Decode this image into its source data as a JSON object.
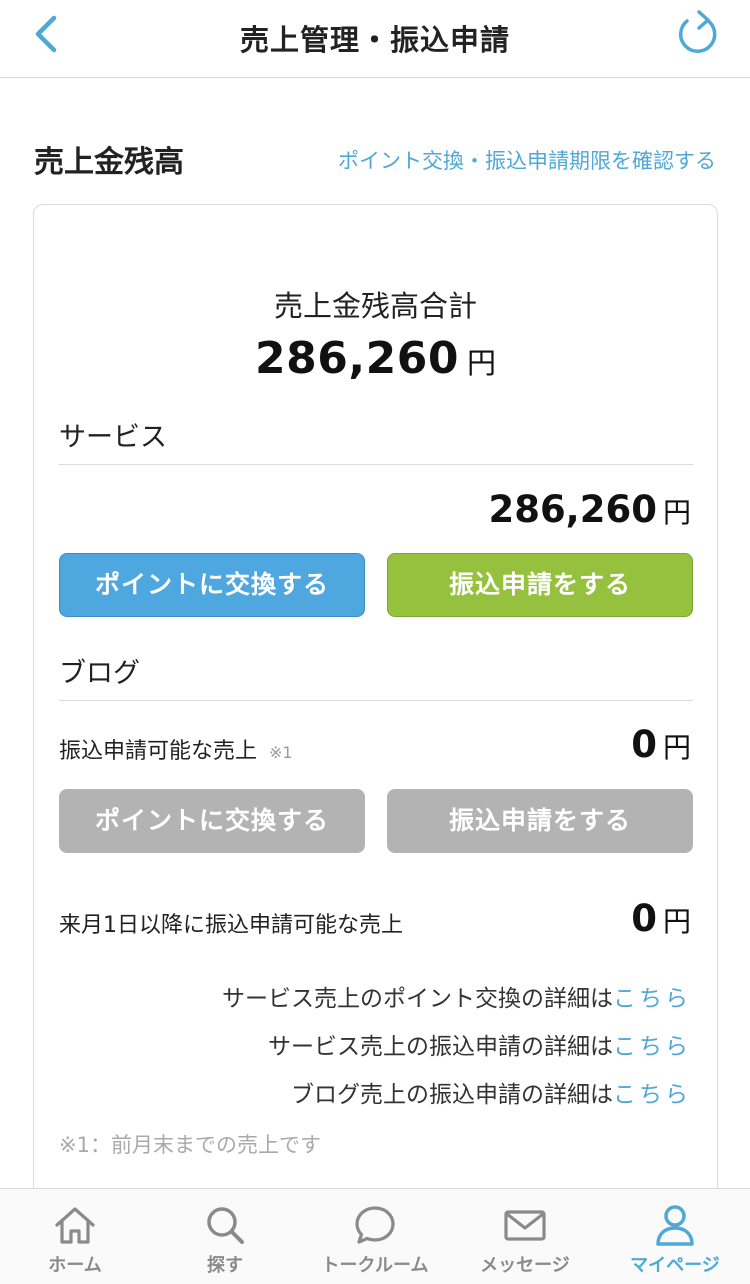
{
  "header": {
    "title": "売上管理・振込申請"
  },
  "section": {
    "title": "売上金残高",
    "period_link": "ポイント交換・振込申請期限を確認する"
  },
  "total": {
    "label": "売上金残高合計",
    "amount": "286,260",
    "unit": "円"
  },
  "service": {
    "heading": "サービス",
    "amount": "286,260",
    "unit": "円",
    "exchange_button": "ポイントに交換する",
    "transfer_button": "振込申請をする"
  },
  "blog": {
    "heading": "ブログ",
    "available_label": "振込申請可能な売上",
    "available_note": "※1",
    "available_amount": "0",
    "available_unit": "円",
    "exchange_button": "ポイントに交換する",
    "transfer_button": "振込申請をする",
    "next_month_label": "来月1日以降に振込申請可能な売上",
    "next_month_amount": "0",
    "next_month_unit": "円"
  },
  "details": [
    {
      "text": "サービス売上のポイント交換の詳細は",
      "link": "こちら"
    },
    {
      "text": "サービス売上の振込申請の詳細は",
      "link": "こちら"
    },
    {
      "text": "ブログ売上の振込申請の詳細は",
      "link": "こちら"
    }
  ],
  "footnote": "※1：前月末までの売上です",
  "tabs": [
    {
      "label": "ホーム",
      "icon": "home-icon"
    },
    {
      "label": "探す",
      "icon": "search-icon"
    },
    {
      "label": "トークルーム",
      "icon": "chat-bubble-icon"
    },
    {
      "label": "メッセージ",
      "icon": "envelope-icon"
    },
    {
      "label": "マイページ",
      "icon": "user-icon",
      "active": true
    }
  ],
  "colors": {
    "accent": "#4fa8d6",
    "blue_button": "#4fa7df",
    "green_button": "#95c13f",
    "disabled_button": "#b3b3b3"
  }
}
